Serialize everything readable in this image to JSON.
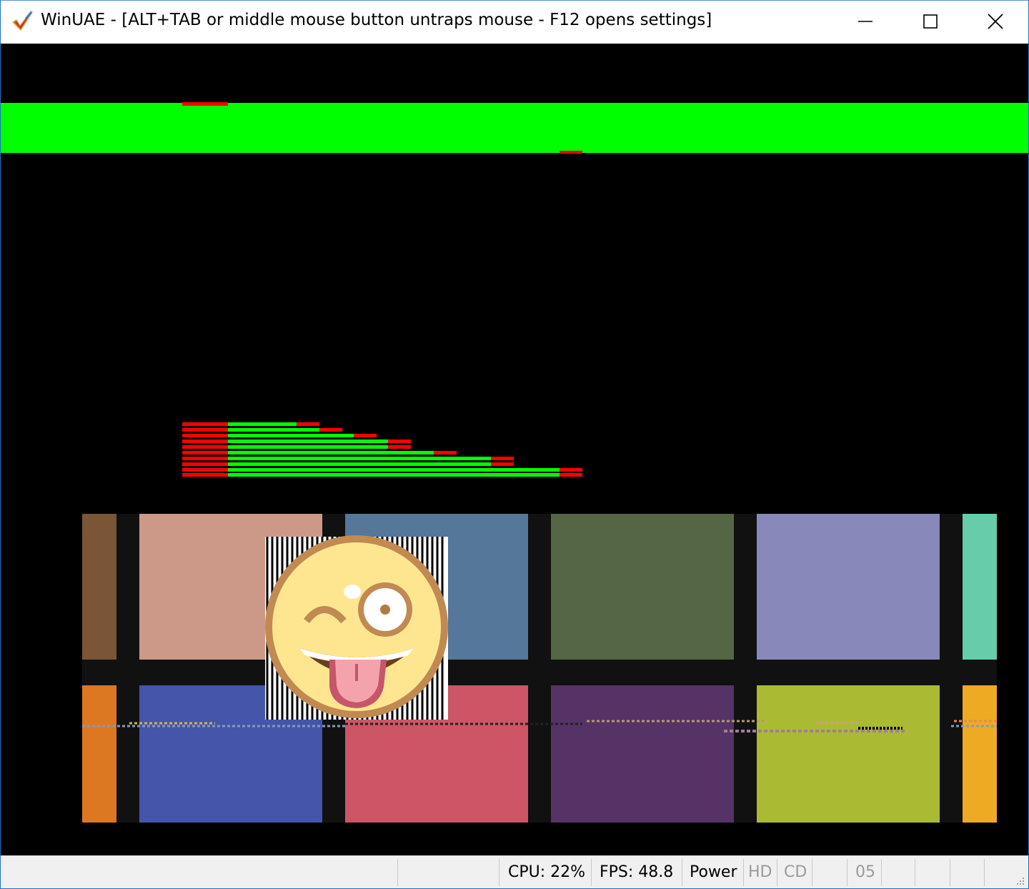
{
  "window": {
    "title": "WinUAE - [ALT+TAB or middle mouse button untraps mouse - F12 opens settings]",
    "icons": [
      "winuae-check-icon",
      "minimize-icon",
      "maximize-icon",
      "close-icon"
    ]
  },
  "screen": {
    "description_colors": {
      "background": "#000000",
      "copper_bar": "#00ff00",
      "marker_red": "#ff0000"
    },
    "emoji_icon": "winking-tongue-face-icon",
    "palette_top": [
      "#7a5636",
      "#cc9988",
      "#557799",
      "#556644",
      "#8888bb",
      "#66ccaa"
    ],
    "palette_bottom": [
      "#dd7722",
      "#4455aa",
      "#cc5566",
      "#553366",
      "#aabb33",
      "#eeaa22"
    ]
  },
  "status": {
    "cpu": "CPU: 22%",
    "fps": "FPS: 48.8",
    "power": "Power",
    "hd": "HD",
    "cd": "CD",
    "track": "05"
  }
}
